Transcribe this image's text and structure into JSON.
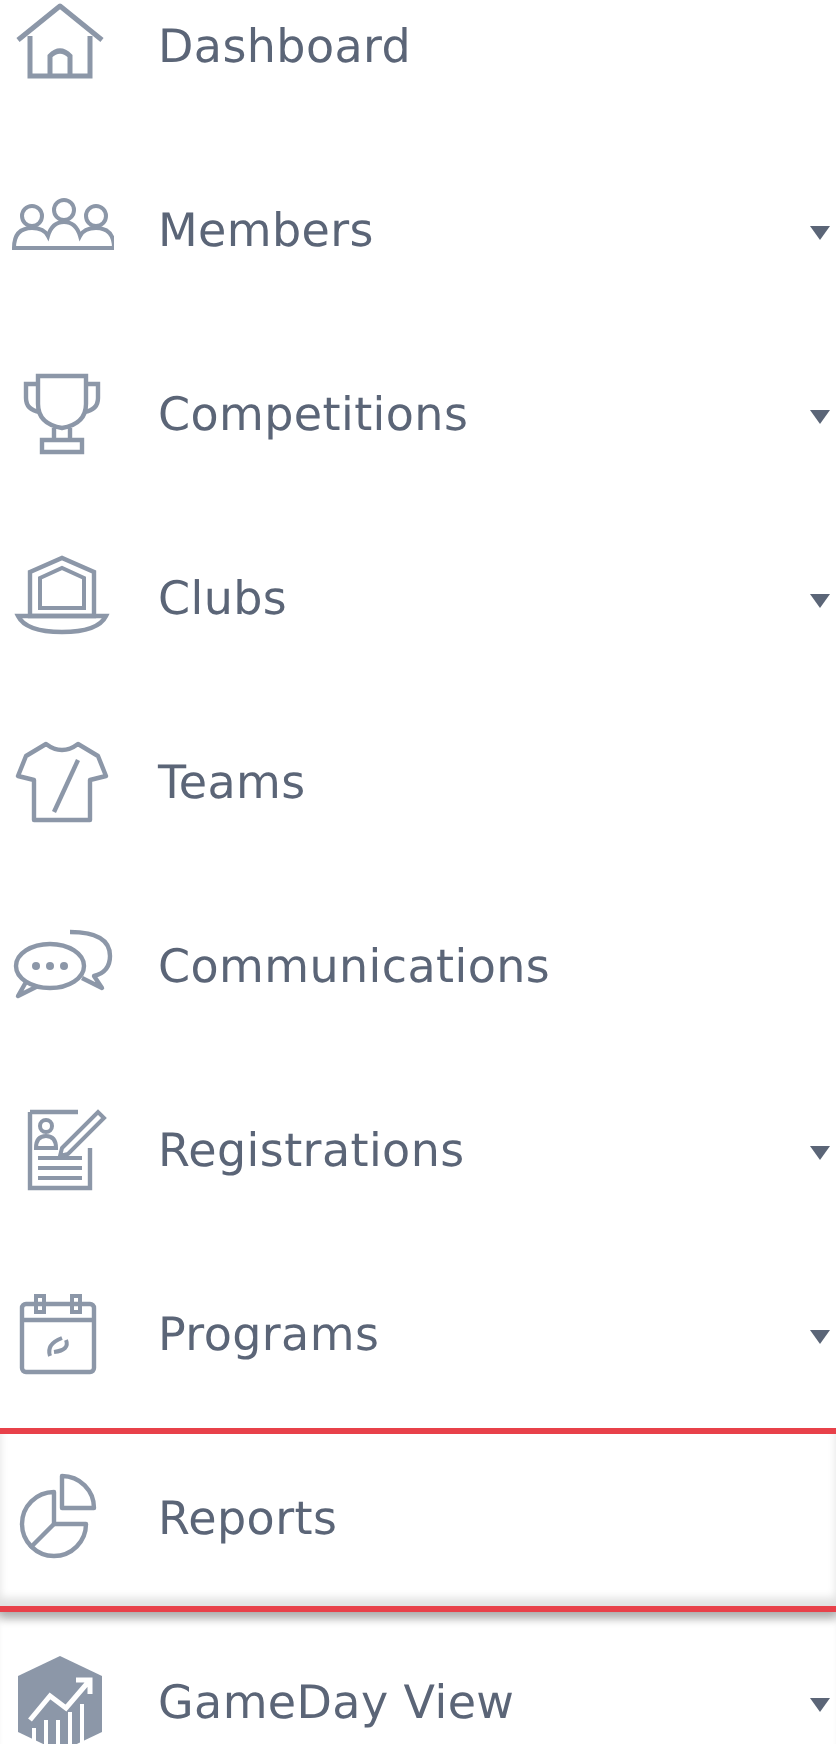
{
  "nav": {
    "items": [
      {
        "label": "Dashboard",
        "expandable": false,
        "selected": false
      },
      {
        "label": "Members",
        "expandable": true,
        "selected": false
      },
      {
        "label": "Competitions",
        "expandable": true,
        "selected": false
      },
      {
        "label": "Clubs",
        "expandable": true,
        "selected": false
      },
      {
        "label": "Teams",
        "expandable": false,
        "selected": false
      },
      {
        "label": "Communications",
        "expandable": false,
        "selected": false
      },
      {
        "label": "Registrations",
        "expandable": true,
        "selected": false
      },
      {
        "label": "Programs",
        "expandable": true,
        "selected": false
      },
      {
        "label": "Reports",
        "expandable": false,
        "selected": true
      },
      {
        "label": "GameDay View",
        "expandable": true,
        "selected": false
      }
    ]
  }
}
